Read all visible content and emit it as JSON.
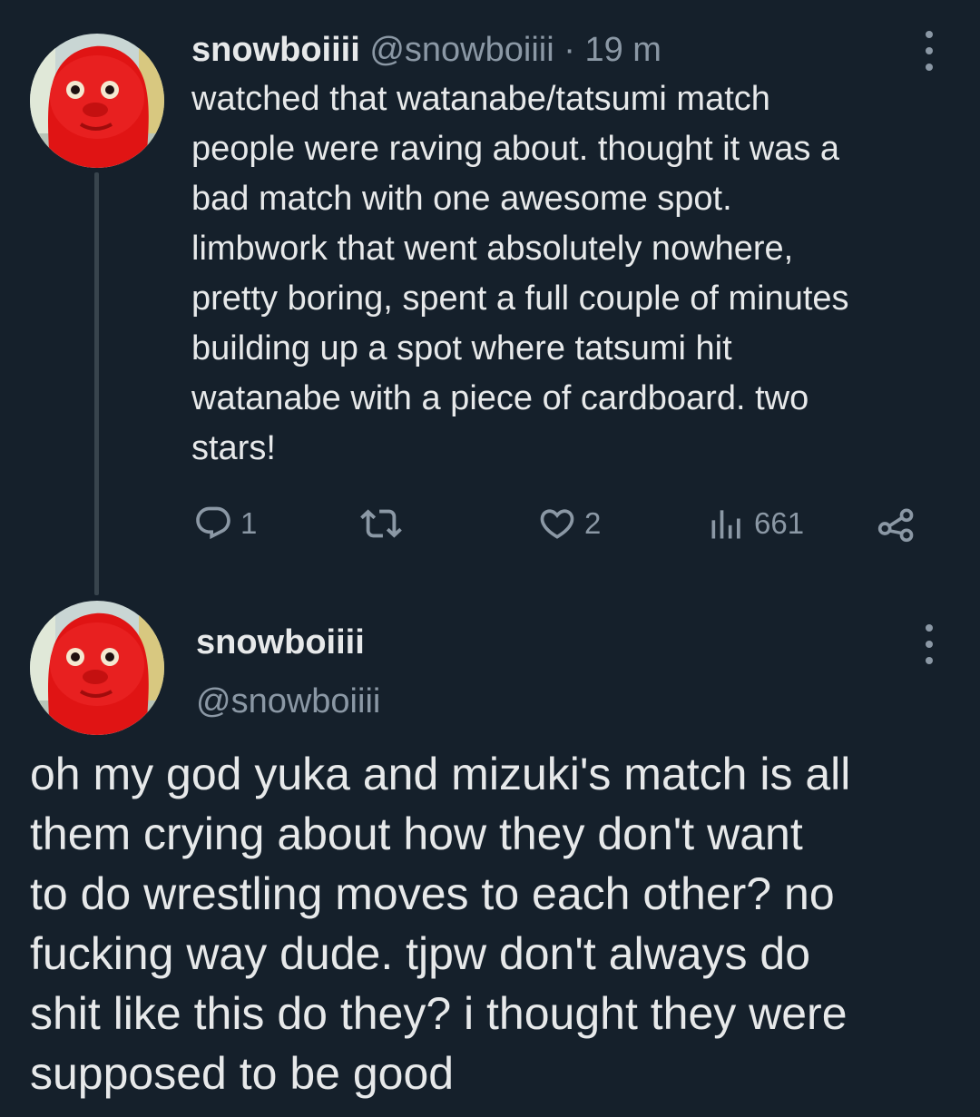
{
  "colors": {
    "background": "#15202b",
    "text_primary": "#e7e9ea",
    "text_secondary": "#8b98a5",
    "thread_line": "#38444d",
    "avatar_red": "#e01414"
  },
  "reply_tweet": {
    "display_name": "snowboiiii",
    "handle": "@snowboiiii",
    "separator": "·",
    "time": "19 m",
    "text_lines": [
      "watched that watanabe/tatsumi match",
      "people were raving about. thought it was a",
      "bad match with one awesome spot.",
      "limbwork that went absolutely nowhere,",
      "pretty boring, spent a full couple of minutes",
      "building up a spot where tatsumi hit",
      "watanabe with a piece of cardboard. two",
      "stars!"
    ],
    "actions": {
      "reply_icon": "speech-bubble-icon",
      "reply_count": "1",
      "retweet_icon": "retweet-arrows-icon",
      "like_icon": "heart-outline-icon",
      "like_count": "2",
      "views_icon": "bar-chart-icon",
      "view_count": "661",
      "share_icon": "share-nodes-icon"
    },
    "more_icon": "vertical-ellipsis-icon"
  },
  "main_tweet": {
    "display_name": "snowboiiii",
    "handle": "@snowboiiii",
    "more_icon": "vertical-ellipsis-icon",
    "text_lines": [
      "oh my god yuka and mizuki's match is all",
      "them crying about how they don't want",
      "to do wrestling moves to each other? no",
      "fucking way dude. tjpw don't always do",
      "shit like this do they? i thought they were",
      "supposed to be good"
    ]
  }
}
